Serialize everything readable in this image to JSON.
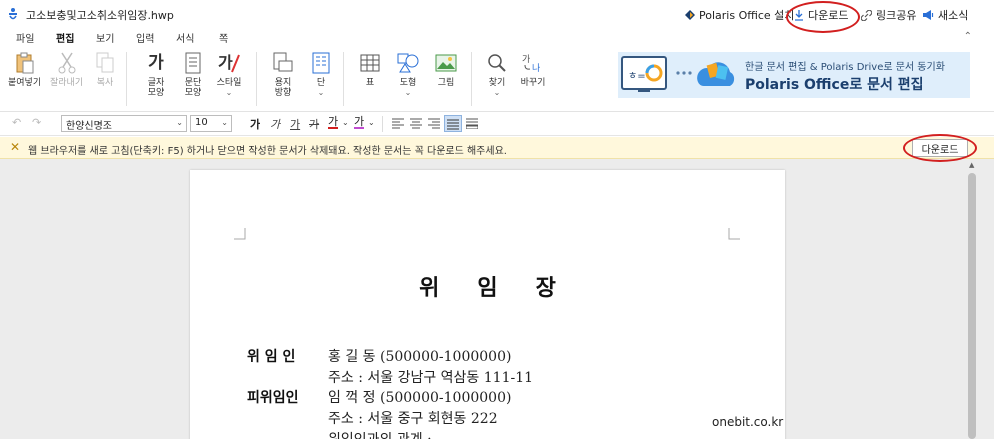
{
  "titlebar": {
    "filename": "고소보충및고소취소위임장.hwp",
    "right_items": {
      "install": "Polaris Office 설치",
      "download": "다운로드",
      "share_link": "링크공유",
      "news": "새소식"
    }
  },
  "menu": {
    "tabs": [
      "파일",
      "편집",
      "보기",
      "입력",
      "서식",
      "쪽"
    ],
    "active": "편집"
  },
  "ribbon": {
    "paste": "붙여넣기",
    "cut": "잘라내기",
    "copy": "복사",
    "char_shape": [
      "글자",
      "모양"
    ],
    "para_shape": [
      "문단",
      "모양"
    ],
    "style": "스타일",
    "paper_dir": [
      "용지",
      "방향"
    ],
    "columns": "단",
    "table": "표",
    "shape": "도형",
    "picture": "그림",
    "find": "찾기",
    "replace": "바꾸기",
    "banner": {
      "line1": "한글 문서 편집 & Polaris Drive로 문서 동기화",
      "line2": "Polaris Office로 문서 편집"
    }
  },
  "formatbar": {
    "font": "한양신명조",
    "size": "10"
  },
  "notice": {
    "message": "웹 브라우저를 새로 고침(단축키: F5) 하거나 닫으면 작성한 문서가 삭제돼요. 작성한 문서는 꼭 다운로드 해주세요.",
    "download_label": "다운로드"
  },
  "document": {
    "title": "위임장",
    "rows": {
      "delegator_label": "위 임 인",
      "delegator_name": "홍   길   동 (500000-1000000)",
      "delegator_addr": "주소 : 서울 강남구 역삼동 111-11",
      "delegatee_label": "피위임인",
      "delegatee_name": "임   꺽   정 (500000-1000000)",
      "delegatee_addr": "주소 : 서울 중구 회현동 222",
      "relation": "위임인과의 관계 :"
    }
  },
  "watermark": "onebit.co.kr",
  "colors": {
    "accent": "#2a6fd6",
    "annotation_circle": "#d21f1f",
    "notice_bg": "#fff8dc",
    "banner_bg": "#dfeefb"
  }
}
